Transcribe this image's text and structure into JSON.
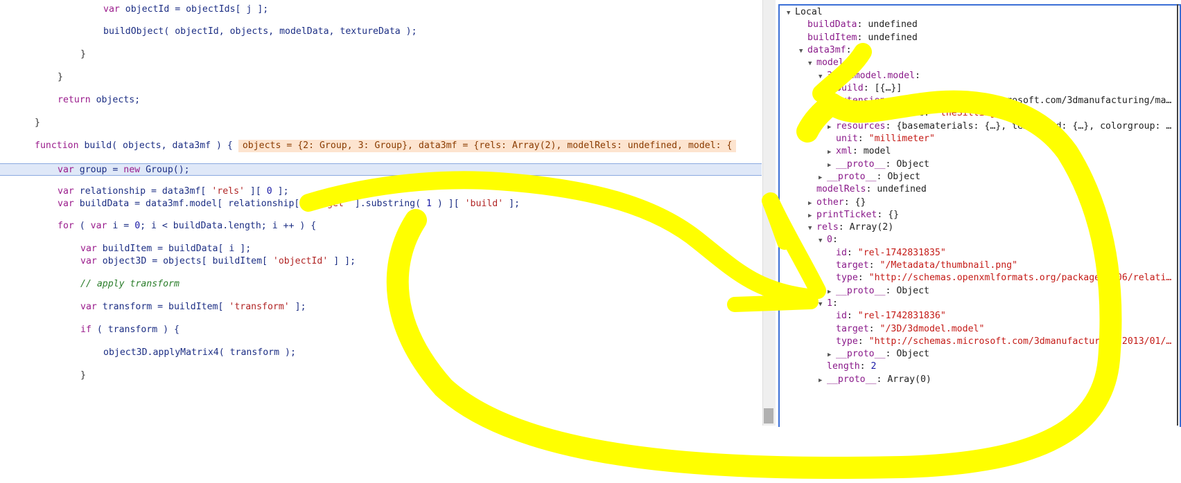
{
  "code": {
    "lines": [
      {
        "indent": 3,
        "parts": [
          [
            "kw",
            "var "
          ],
          [
            "id",
            "objectId = objectIds[ j ];"
          ]
        ]
      },
      {
        "indent": 3,
        "parts": [
          [
            "id",
            "buildObject( objectId, objects, modelData, textureData );"
          ]
        ]
      },
      {
        "indent": 2,
        "parts": [
          [
            "op",
            "}"
          ]
        ]
      },
      {
        "indent": 1,
        "parts": [
          [
            "op",
            "}"
          ]
        ]
      },
      {
        "indent": 1,
        "parts": [
          [
            "kw",
            "return "
          ],
          [
            "id",
            "objects;"
          ]
        ]
      },
      {
        "indent": 0,
        "parts": [
          [
            "op",
            "}"
          ]
        ]
      },
      {
        "indent": 0,
        "parts": [
          [
            "kw",
            "function "
          ],
          [
            "id",
            "build( objects, data3mf ) {"
          ]
        ]
      },
      {
        "indent": 1,
        "parts": [
          [
            "kw",
            "var "
          ],
          [
            "id",
            "group = "
          ],
          [
            "kw",
            "new "
          ],
          [
            "id",
            "Group();"
          ]
        ]
      },
      {
        "indent": 1,
        "parts": [
          [
            "kw",
            "var "
          ],
          [
            "id",
            "relationship = data3mf[ "
          ],
          [
            "str",
            "'rels'"
          ],
          [
            "id",
            " ][ "
          ],
          [
            "num",
            "0"
          ],
          [
            "id",
            " ];"
          ]
        ]
      },
      {
        "indent": 1,
        "parts": [
          [
            "kw",
            "var "
          ],
          [
            "id",
            "buildData = data3mf.model[ relationship[ "
          ],
          [
            "str",
            "'target'"
          ],
          [
            "id",
            " ].substring( "
          ],
          [
            "num",
            "1"
          ],
          [
            "id",
            " ) ][ "
          ],
          [
            "str",
            "'build'"
          ],
          [
            "id",
            " ];"
          ]
        ]
      },
      {
        "indent": 1,
        "parts": [
          [
            "kw",
            "for "
          ],
          [
            "id",
            "( "
          ],
          [
            "kw",
            "var "
          ],
          [
            "id",
            "i = "
          ],
          [
            "num",
            "0"
          ],
          [
            "id",
            "; i < buildData.length; i ++ ) {"
          ]
        ]
      },
      {
        "indent": 2,
        "parts": [
          [
            "kw",
            "var "
          ],
          [
            "id",
            "buildItem = buildData[ i ];"
          ]
        ]
      },
      {
        "indent": 2,
        "parts": [
          [
            "kw",
            "var "
          ],
          [
            "id",
            "object3D = objects[ buildItem[ "
          ],
          [
            "str",
            "'objectId'"
          ],
          [
            "id",
            " ] ];"
          ]
        ]
      },
      {
        "indent": 2,
        "parts": [
          [
            "cmt",
            "// apply transform"
          ]
        ]
      },
      {
        "indent": 2,
        "parts": [
          [
            "kw",
            "var "
          ],
          [
            "id",
            "transform = buildItem[ "
          ],
          [
            "str",
            "'transform'"
          ],
          [
            "id",
            " ];"
          ]
        ]
      },
      {
        "indent": 2,
        "parts": [
          [
            "kw",
            "if "
          ],
          [
            "id",
            "( transform ) {"
          ]
        ]
      },
      {
        "indent": 3,
        "parts": [
          [
            "id",
            "object3D.applyMatrix4( transform );"
          ]
        ]
      },
      {
        "indent": 2,
        "parts": [
          [
            "op",
            "}"
          ]
        ]
      }
    ],
    "inline_value": "objects = {2: Group, 3: Group}, data3mf = {rels: Array(2), modelRels: undefined, model: {"
  },
  "scope": {
    "rows": [
      {
        "depth": 0,
        "tri": "down",
        "key": "Local",
        "val": "",
        "vtype": "plain"
      },
      {
        "depth": 1,
        "tri": "",
        "key": "buildData",
        "val": "undefined",
        "vtype": "plain"
      },
      {
        "depth": 1,
        "tri": "",
        "key": "buildItem",
        "val": "undefined",
        "vtype": "plain"
      },
      {
        "depth": 1,
        "tri": "down",
        "key": "data3mf",
        "val": "",
        "vtype": "plain"
      },
      {
        "depth": 2,
        "tri": "down",
        "key": "model",
        "val": "",
        "vtype": "plain"
      },
      {
        "depth": 3,
        "tri": "down",
        "key": "3D/3dmodel.model",
        "val": "",
        "vtype": "plain"
      },
      {
        "depth": 4,
        "tri": "right",
        "key": "build",
        "val": "[{…}]",
        "vtype": "plain"
      },
      {
        "depth": 4,
        "tri": "right",
        "key": "extensions",
        "val": "{http://schemas.microsoft.com/3dmanufacturing/ma…",
        "vtype": "plain"
      },
      {
        "depth": 4,
        "tri": "right",
        "key": "metadata",
        "val": "{Title: \"theSittingWoman\"}",
        "vtype": "mixed"
      },
      {
        "depth": 4,
        "tri": "right",
        "key": "resources",
        "val": "{basematerials: {…}, texture2d: {…}, colorgroup: …",
        "vtype": "plain"
      },
      {
        "depth": 4,
        "tri": "",
        "key": "unit",
        "val": "\"millimeter\"",
        "vtype": "str"
      },
      {
        "depth": 4,
        "tri": "right",
        "key": "xml",
        "val": "model",
        "vtype": "plain"
      },
      {
        "depth": 4,
        "tri": "right",
        "key": "__proto__",
        "val": "Object",
        "vtype": "plain"
      },
      {
        "depth": 3,
        "tri": "right",
        "key": "__proto__",
        "val": "Object",
        "vtype": "plain"
      },
      {
        "depth": 2,
        "tri": "",
        "key": "modelRels",
        "val": "undefined",
        "vtype": "plain"
      },
      {
        "depth": 2,
        "tri": "right",
        "key": "other",
        "val": "{}",
        "vtype": "plain"
      },
      {
        "depth": 2,
        "tri": "right",
        "key": "printTicket",
        "val": "{}",
        "vtype": "plain"
      },
      {
        "depth": 2,
        "tri": "down",
        "key": "rels",
        "val": "Array(2)",
        "vtype": "plain"
      },
      {
        "depth": 3,
        "tri": "down",
        "key": "0",
        "val": "",
        "vtype": "plain"
      },
      {
        "depth": 4,
        "tri": "",
        "key": "id",
        "val": "\"rel-1742831835\"",
        "vtype": "str"
      },
      {
        "depth": 4,
        "tri": "",
        "key": "target",
        "val": "\"/Metadata/thumbnail.png\"",
        "vtype": "str"
      },
      {
        "depth": 4,
        "tri": "",
        "key": "type",
        "val": "\"http://schemas.openxmlformats.org/package/2006/relati…",
        "vtype": "str"
      },
      {
        "depth": 4,
        "tri": "right",
        "key": "__proto__",
        "val": "Object",
        "vtype": "plain"
      },
      {
        "depth": 3,
        "tri": "down",
        "key": "1",
        "val": "",
        "vtype": "plain"
      },
      {
        "depth": 4,
        "tri": "",
        "key": "id",
        "val": "\"rel-1742831836\"",
        "vtype": "str"
      },
      {
        "depth": 4,
        "tri": "",
        "key": "target",
        "val": "\"/3D/3dmodel.model\"",
        "vtype": "str"
      },
      {
        "depth": 4,
        "tri": "",
        "key": "type",
        "val": "\"http://schemas.microsoft.com/3dmanufacturing/2013/01/…",
        "vtype": "str"
      },
      {
        "depth": 4,
        "tri": "right",
        "key": "__proto__",
        "val": "Object",
        "vtype": "plain"
      },
      {
        "depth": 3,
        "tri": "",
        "key": "length",
        "val": "2",
        "vtype": "num"
      },
      {
        "depth": 3,
        "tri": "right",
        "key": "__proto__",
        "val": "Array(0)",
        "vtype": "plain"
      }
    ]
  },
  "colors": {
    "annotation_yellow": "#ffff00",
    "active_line_bg": "#dfe8f8",
    "inline_value_bg": "#fde4cf",
    "scope_border": "#3b6fd6"
  },
  "icons": [
    "expand-triangle-icon",
    "collapse-triangle-icon"
  ]
}
